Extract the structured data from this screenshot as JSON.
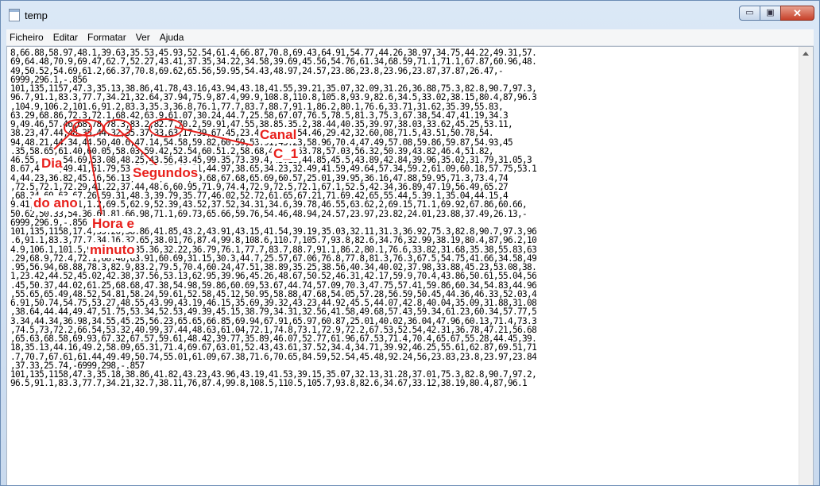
{
  "window": {
    "title": "temp",
    "buttons": {
      "minimize": "▭",
      "maximize": "▣",
      "close": "✕"
    }
  },
  "menu": [
    "Ficheiro",
    "Editar",
    "Formatar",
    "Ver",
    "Ajuda"
  ],
  "content_lines": [
    "8,66.88,58.97,48.1,39.63,35.53,45.93,52.54,61.4,66.87,70.8,69.43,64.91,54.77,44.26,38.97,34.75,44.22,49.31,57.",
    "69,64.48,70.9,69.47,62.7,52.27,43.41,37.35,34.22,34.58,39.69,45.56,54.76,61.34,68.59,71.1,71.1,67.87,60.96,48.",
    "49,50.52,54.69,61.2,66.37,70.8,69.62,65.56,59.95,54.43,48.97,24.57,23.86,23.8,23.96,23.87,37.87,26.47,-",
    "6999,296.1,-.856",
    "101,135,1157,47.3,35.13,38.86,41.78,43.16,43.94,43.18,41.55,39.21,35.07,32.09,31.26,36.88,75.3,82.8,90.7,97.3,",
    "96.7,91.1,83.3,77.7,34.21,32.64,37.94,75.9,87.4,99.9,108.8,110.8,105.8,93.9,82.6,34.5,33.02,38.15,80.4,87,96.3",
    ",104.9,106.2,101.6,91.2,83.3,35.3,36.8,76.1,77.7,83.7,88.7,91.1,86.2,80.1,76.6,33.71,31.62,35.39,55.83,",
    "63.29,68.86,72.3,72.1,68.42,63.9,61.07,30.24,44.7,25.58,67.07,76.5,78.5,81.3,75.3,67.38,54.47,41.19,34.3",
    "9,49.46,57.46,68.78,78.3,83.2,82.7,70.2,59.91,47.55,38.85,35.2,38.44,40.35,39.97,38.03,33.62,45.25,53.11,",
    "38.23,47.44,48.35,44.32,35.37,33.63,17.39,67.45,23.48,66.50,54.46,29.42,32.60,08,71.5,43.51,50.78,54.",
    "94,48.21,44.34,44.50,40.6,47.14,54.58,59.82,60.59,53.91,45.23,58.96,70.4,47.49,57.08,59.86,59.87,54.93,45",
    ".35,58.65,61.40,60.05,58.03,59.42,52.54,60.51.2,58.68,47.61,53.78,57.03,56.32,50.39,43.82,46.4,51.82,",
    "46.55,59.4,54.69,53.08,48.25,43.56,43.45,99.35,73.39.4,43.18,44.85,45.5,43.89,42.84,39.96,35.02,31.79,31.05,3",
    "8.67,44.42,49.41,51.79,53.26,52.37,49.31,44.97,38.65,34.23,32.49,41.59,49.64,57.34,59.2,61.09,60.18,57.75,53.1",
    "4,44.23,36.82,45.16,56.13,65.46,66.73,69.68,67.68,65.69,60.57,25.01,39.95,36.16,47.88,59.95,71.3,73.4,74",
    ",72.5,72.1,72.29,41.22,37.44,48.6,60.95,71.9,74.4,72.9,72.5,72.1,67.1,52.5,42.34,36.89,47.19,56.49,65.27",
    ",68.34,69.63,67.26,59.31,48.3,39.79,35.77,46.02,52.72,61.65,67.21,71.69.42,65,55.44,5.39.1,35.04,44.15,4",
    "9.41,57.85,64.1,1.2,69.5,62.9,52.39,43.52,37.52,34.31,34.6,39.78,46.55,63.62,2,69.15,71.1,69.92,67.86,60.66,",
    "50.62,50.33,54.36,61.81,66.98,71.1,69.73,65.66,59.76,54.46,48.94,24.57,23.97,23.82,24.01,23.88,37.49,26.13,-",
    "6999,296.9,-.856",
    "101,135,1158,17.4,35.26,38.86,41.85,43.2,43.91,43.15,41.54,39.19,35.03,32.11,31.3,36.92,75.3,82.8,90.7,97.3,96",
    ".6,91.1,83.3,77.7,34.16,32.65,38.01,76,87.4,99.8,108.6,110.7,105.7,93.8,82.6,34.76,32.99,38.19,80.4,87,96.2,10",
    "4.9,106.1,101.5,91.2,83.3,35.36,32.22,36.79,76.1,77.7,83.7,88.7,91.1,86.2,80.1,76.6,33.82,31.68,35.38,55.83,63",
    ".29,68.9,72.4,72.1,68.46,63.91,60.69,31.15,30.3,44.7,25.57,67.06,76.8,77.8,81.3,76.3,67.5,54.75,41.66,34.58,49",
    ".95,56.94,68.88,78.3,82.9,83.2,79.5,70.4,60.24,47.51,38.89,35.25,38.56,40.34,40.02,37.98,33.88,45.23,53.08,38.",
    "1,23.42,44.52,45.02,42.38,37.56,53.13,62.95,39.96,45.26,48.67,50.52,46.31,42.17,59.9,70.4,43.86,50.61,55.04,56",
    ".45,50.37,44.02,61.25,68.68,47.38,54.98,59.86,60.69,53.67,44.74,57.09,70.3,47.75,57.41,59.86,60.34,54.83,44.96",
    ",55.65,65.49,48.52,54.81,58.24,59.61,52.58,45.12,50.95,58.88,47.68,54.05,57.28,56.59,50.45,44.36,46.33,52.03,4",
    "6.91,50.74,54.75,53.27,48.55,43.99,43.19,46.15,35.69,39.32,43.23,44.92,45.5,44.07,42.8,40.04,35.09,31.88,31.08",
    ",38.64,44.44,49.47,51.75,53.34,52.53,49.39,45.15,38.79,34.31,32.56,41.58,49.68,57.43,59.34,61.23,60.34,57.77,5",
    "3.34,44.34,36.98,34.55,45.25,56.23,65.65,66.85,69.94,67.91,65.97,60.87,25.01,40.02,36.04,47.96,60.13,71.4,73.3",
    ",74.5,73,72.2,66.54,53.32,40.99,37.44,48.63,61.04,72.1,74.8,73.1,72.9,72.2,67.53,52.54,42.31,36.78,47.21,56.68",
    ",65.63,68.58,69.93,67.32,67.57,59.61,48.42,39.77,35.89,46.07,52.77,61.96,67.53,71.4,70.4,65.67,55.28,44.45,39.",
    "18,35.13,44.16,49.2,58.09,65.31,71.4,69.67,63.01,52.43,43.61,37.52,34.4,34.71,39.92,46.25,55.61,62.87,69.51,71",
    ".7,70.7,67.61,61.44,49.49,50.74,55.01,61.09,67.38,71.6,70.65,84.59,52.54,45.48,92.24,56,23.83,23.8,23.97,23.84",
    ",37.33,25.74,-6999,298,-.857",
    "101,135,1158,47.3,35.18,38.86,41.82,43.23,43.96,43.19,41.53,39.15,35.07,32.13,31.28,37.01,75.3,82.8,90.7,97.2,",
    "96.5,91.1,83.3,77.7,34.21,32.7,38.11,76,87.4,99.8,108.5,110.5,105.7,93.8,82.6,34.67,33.12,38.19,80.4,87,96.1"
  ],
  "annotations": {
    "dia_do_ano": [
      "Dia",
      "do ano"
    ],
    "hora_e_minuto": [
      "Hora e",
      "minuto"
    ],
    "segundos": "Segundos",
    "canal": [
      "Canal",
      "C_1"
    ]
  }
}
